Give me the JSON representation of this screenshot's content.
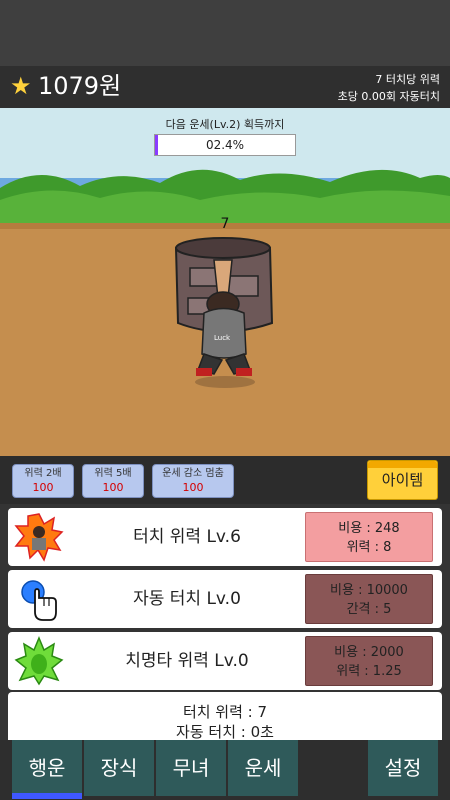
{
  "header": {
    "star_icon": "star-icon",
    "money": "1079원",
    "per_touch": "7 터치당 위력",
    "auto_touch": "초당 0.00회 자동터치"
  },
  "scene": {
    "progress_label": "다음 운세(Lv.2) 획득까지",
    "progress_text": "02.4%",
    "progress_value": 0.024,
    "hit_number": "7",
    "shirt_text": "Luck"
  },
  "boosts": [
    {
      "label": "위력 2배",
      "price": "100"
    },
    {
      "label": "위력 5배",
      "price": "100"
    },
    {
      "label": "운세 감소 멈춤",
      "price": "100"
    }
  ],
  "item_button": "아이템",
  "upgrades": [
    {
      "icon": "fire-character-icon",
      "title": "터치 위력 Lv.6",
      "cost_line": "비용 : 248",
      "stat_line": "위력 : 8"
    },
    {
      "icon": "touch-hand-icon",
      "title": "자동 터치 Lv.0",
      "cost_line": "비용 : 10000",
      "stat_line": "간격 : 5"
    },
    {
      "icon": "green-aura-icon",
      "title": "치명타 위력 Lv.0",
      "cost_line": "비용 : 2000",
      "stat_line": "위력 : 1.25"
    }
  ],
  "stats": {
    "line1": "터치 위력 : 7",
    "line2": "자동 터치 : 0초"
  },
  "tabs": [
    "행운",
    "장식",
    "무녀",
    "운세",
    "설정"
  ],
  "colors": {
    "accent": "#3f58ff",
    "item": "#ffd03a",
    "progress_fill": "#8a3cff",
    "tab_bg": "#2f5a5a"
  }
}
